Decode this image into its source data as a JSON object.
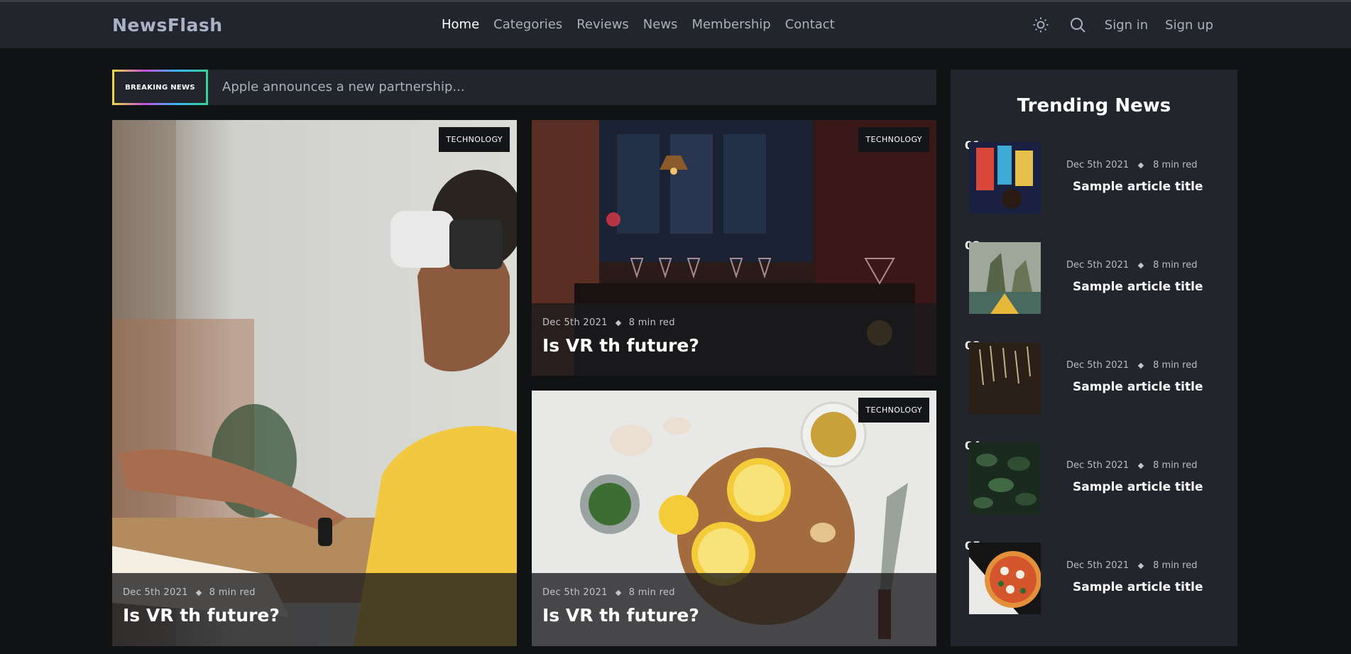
{
  "header": {
    "logo": "NewsFlash",
    "nav": [
      "Home",
      "Categories",
      "Reviews",
      "News",
      "Membership",
      "Contact"
    ],
    "sign_in": "Sign in",
    "sign_up": "Sign up"
  },
  "breaking": {
    "tag": "BREAKING NEWS",
    "text": "Apple announces a new partnership..."
  },
  "cards": [
    {
      "category": "TECHNOLOGY",
      "date": "Dec 5th 2021",
      "read": "8 min red",
      "title": "Is VR th future?"
    },
    {
      "category": "TECHNOLOGY",
      "date": "Dec 5th 2021",
      "read": "8 min red",
      "title": "Is VR th future?"
    },
    {
      "category": "TECHNOLOGY",
      "date": "Dec 5th 2021",
      "read": "8 min red",
      "title": "Is VR th future?"
    }
  ],
  "trending": {
    "heading": "Trending News",
    "items": [
      {
        "num": "01",
        "date": "Dec 5th 2021",
        "read": "8 min red",
        "title": "Sample article title"
      },
      {
        "num": "02",
        "date": "Dec 5th 2021",
        "read": "8 min red",
        "title": "Sample article title"
      },
      {
        "num": "03",
        "date": "Dec 5th 2021",
        "read": "8 min red",
        "title": "Sample article title"
      },
      {
        "num": "04",
        "date": "Dec 5th 2021",
        "read": "8 min red",
        "title": "Sample article title"
      },
      {
        "num": "05",
        "date": "Dec 5th 2021",
        "read": "8 min red",
        "title": "Sample article title"
      }
    ]
  },
  "colors": {
    "background": "#111214",
    "panel": "#23252c",
    "accent_text": "#aab2c8"
  },
  "icons": [
    "sun-icon",
    "search-icon"
  ]
}
